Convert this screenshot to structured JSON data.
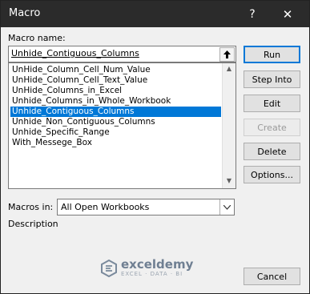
{
  "window": {
    "title": "Macro",
    "help_glyph": "?",
    "close_glyph": "✕"
  },
  "macro_name": {
    "label": "Macro name:",
    "value": "Unhide_Contiguous_Columns"
  },
  "macro_list": {
    "items": [
      "UnHide_Column_Cell_Num_Value",
      "UnHide_Column_Cell_Text_Value",
      "UnHide_Columns_in_Excel",
      "Unhide_Columns_in_Whole_Workbook",
      "Unhide_Contiguous_Columns",
      "Unhide_Non_Contiguous_Columns",
      "Unhide_Specific_Range",
      "With_Messege_Box"
    ],
    "selected_index": 4
  },
  "buttons": {
    "run": "Run",
    "step_into": "Step Into",
    "edit": "Edit",
    "create": "Create",
    "delete": "Delete",
    "options": "Options...",
    "cancel": "Cancel"
  },
  "macros_in": {
    "label": "Macros in:",
    "value": "All Open Workbooks"
  },
  "description": {
    "label": "Description"
  },
  "watermark": {
    "name": "exceldemy",
    "tagline": "EXCEL · DATA · BI"
  },
  "colors": {
    "selection": "#0078d7",
    "titlebar": "#2b2b2b"
  }
}
